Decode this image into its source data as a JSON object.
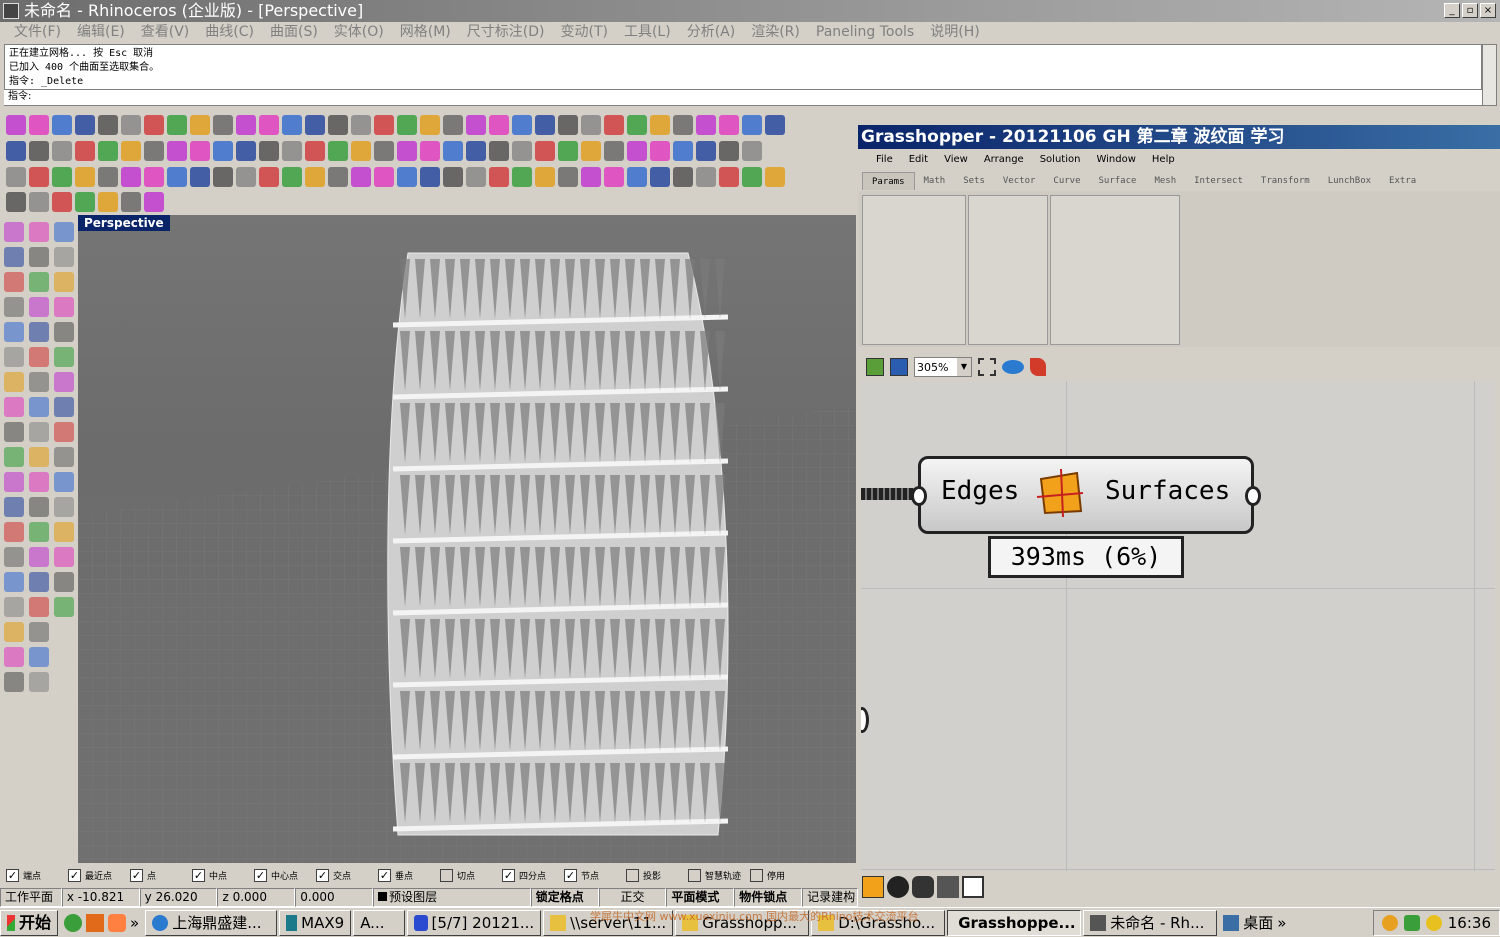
{
  "window": {
    "title": "未命名 - Rhinoceros (企业版) - [Perspective]",
    "min": "_",
    "max": "▫",
    "close": "×"
  },
  "menu": [
    "文件(F)",
    "编辑(E)",
    "查看(V)",
    "曲线(C)",
    "曲面(S)",
    "实体(O)",
    "网格(M)",
    "尺寸标注(D)",
    "变动(T)",
    "工具(L)",
    "分析(A)",
    "渲染(R)",
    "Paneling Tools",
    "说明(H)"
  ],
  "command": {
    "history": [
      "正在建立网格... 按 Esc 取消",
      "已加入 400 个曲面至选取集合。",
      "指令: _Delete"
    ],
    "prompt": "指令:"
  },
  "viewport": {
    "label": "Perspective"
  },
  "snaps": [
    {
      "label": "端点",
      "checked": true
    },
    {
      "label": "最近点",
      "checked": true
    },
    {
      "label": "点",
      "checked": true
    },
    {
      "label": "中点",
      "checked": true
    },
    {
      "label": "中心点",
      "checked": true
    },
    {
      "label": "交点",
      "checked": true
    },
    {
      "label": "垂点",
      "checked": true
    },
    {
      "label": "切点",
      "checked": false
    },
    {
      "label": "四分点",
      "checked": true
    },
    {
      "label": "节点",
      "checked": true
    },
    {
      "label": "投影",
      "checked": false
    },
    {
      "label": "智慧轨迹",
      "checked": false
    },
    {
      "label": "停用",
      "checked": false
    }
  ],
  "status": {
    "plane": "工作平面",
    "x": "x -10.821",
    "y": "y 26.020",
    "z": "z 0.000",
    "d": "0.000",
    "layer": "预设图层",
    "grid_lock": "锁定格点",
    "ortho": "正交",
    "planar": "平面模式",
    "osnap": "物件锁点",
    "history": "记录建构"
  },
  "grasshopper": {
    "title": "Grasshopper - 20121106 GH 第二章 波纹面 学习",
    "menu": [
      "File",
      "Edit",
      "View",
      "Arrange",
      "Solution",
      "Window",
      "Help"
    ],
    "tabs": [
      "Params",
      "Math",
      "Sets",
      "Vector",
      "Curve",
      "Surface",
      "Mesh",
      "Intersect",
      "Transform",
      "LunchBox",
      "Extra"
    ],
    "active_tab": "Params",
    "zoom": "305%",
    "component": {
      "input": "Edges",
      "output": "Surfaces"
    },
    "timer": "393ms  (6%)"
  },
  "taskbar": {
    "start": "开始",
    "tasks": [
      {
        "label": "上海鼎盛建...",
        "pressed": false
      },
      {
        "label": "MAX9",
        "pressed": false
      },
      {
        "label": "A...",
        "pressed": false
      },
      {
        "label": "[5/7] 20121...",
        "pressed": false
      },
      {
        "label": "\\\\server\\11...",
        "pressed": false
      },
      {
        "label": "Grasshopp...",
        "pressed": false
      },
      {
        "label": "D:\\Grassho...",
        "pressed": false
      },
      {
        "label": "Grasshoppe...",
        "pressed": true
      },
      {
        "label": "未命名 - Rh...",
        "pressed": false
      }
    ],
    "desktop": "桌面",
    "time": "16:36"
  },
  "watermark": "学犀牛中文网 www.xuexiniu.com 国内最大的Rhino技术交流平台"
}
